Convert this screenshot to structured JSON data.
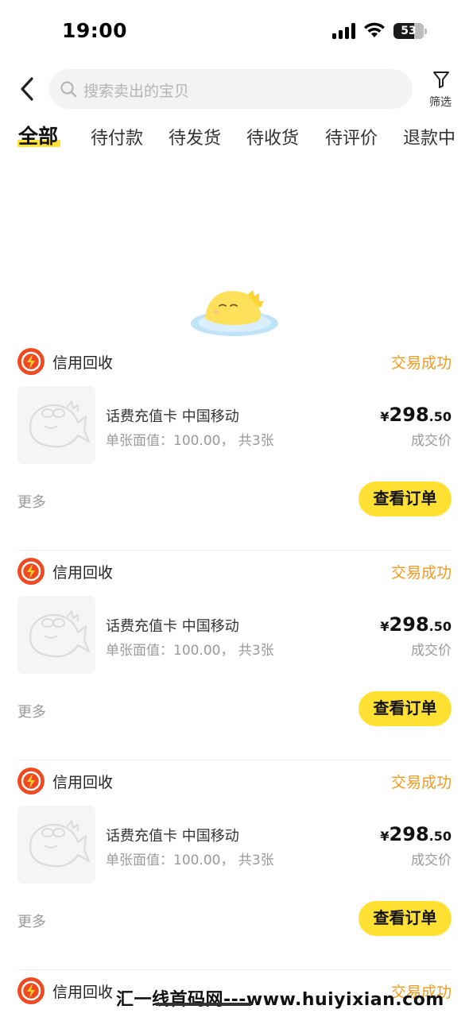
{
  "status_bar": {
    "time": "19:00",
    "battery": "53"
  },
  "search": {
    "placeholder": "搜索卖出的宝贝"
  },
  "filter": {
    "label": "筛选"
  },
  "tabs": [
    {
      "label": "全部",
      "active": true
    },
    {
      "label": "待付款"
    },
    {
      "label": "待发货"
    },
    {
      "label": "待收货"
    },
    {
      "label": "待评价"
    },
    {
      "label": "退款中"
    }
  ],
  "colors": {
    "accent": "#ffe033",
    "status": "#f29a1a",
    "logo": "#f04a23"
  },
  "orders": [
    {
      "shop": "信用回收",
      "status": "交易成功",
      "title": "话费充值卡 中国移动",
      "spec": "单张面值：100.00， 共3张",
      "price_symbol": "¥",
      "price_int": "298",
      "price_dec": ".50",
      "price_label": "成交价",
      "more": "更多",
      "action": "查看订单"
    },
    {
      "shop": "信用回收",
      "status": "交易成功",
      "title": "话费充值卡 中国移动",
      "spec": "单张面值：100.00， 共3张",
      "price_symbol": "¥",
      "price_int": "298",
      "price_dec": ".50",
      "price_label": "成交价",
      "more": "更多",
      "action": "查看订单"
    },
    {
      "shop": "信用回收",
      "status": "交易成功",
      "title": "话费充值卡 中国移动",
      "spec": "单张面值：100.00， 共3张",
      "price_symbol": "¥",
      "price_int": "298",
      "price_dec": ".50",
      "price_label": "成交价",
      "more": "更多",
      "action": "查看订单"
    },
    {
      "shop": "信用回收",
      "status": "交易成功"
    }
  ],
  "watermark": "汇一线首码网---www.huiyixian.com"
}
